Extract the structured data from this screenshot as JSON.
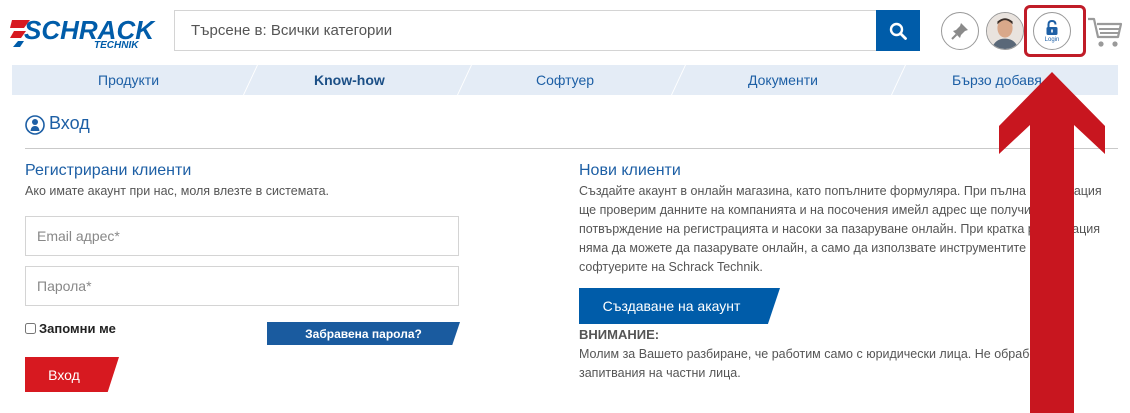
{
  "brand": {
    "name": "SCHRACK",
    "subname": "TECHNIK",
    "blue": "#005ca9",
    "red": "#d71920"
  },
  "search": {
    "placeholder": "Търсене в: Всички категории",
    "icon": "search-icon"
  },
  "header_icons": {
    "pin": "pin-icon",
    "avatar": "user-avatar",
    "login_label": "Login",
    "lock": "lock-icon",
    "cart": "cart-icon"
  },
  "nav": {
    "items": [
      {
        "label": "Продукти"
      },
      {
        "label": "Know-how"
      },
      {
        "label": "Софтуер"
      },
      {
        "label": "Документи"
      },
      {
        "label": "Бързо добавя"
      }
    ]
  },
  "page": {
    "title": "Вход"
  },
  "registered": {
    "heading": "Регистрирани клиенти",
    "note": "Ако имате акаунт при нас, моля влезте в системата.",
    "email_placeholder": "Email адрес*",
    "password_placeholder": "Парола*",
    "remember_label": "Запомни ме",
    "forgot_label": "Забравена парола?",
    "submit_label": "Вход"
  },
  "new_customers": {
    "heading": "Нови клиенти",
    "lines": [
      "Създайте акаунт в онлайн магазина, като попълните формуляра. При пълна регистрация",
      "ще проверим данните на компанията и на посочения имейл адрес ще получите",
      "потвърждение на регистрацията и насоки за пазаруване онлайн. При кратка регистрация",
      "няма да можете да пазарувате онлайн, а само да използвате инструментите и",
      "софтуерите на Schrack Technik."
    ],
    "create_label": "Създаване на акаунт",
    "warning_heading": "ВНИМАНИЕ:",
    "warning_lines": [
      "Молим за Вашето разбиране, че работим само с юридически лица. Не обработваме",
      "запитвания на частни лица."
    ]
  },
  "annotation": {
    "highlight_color": "#c01c28"
  }
}
